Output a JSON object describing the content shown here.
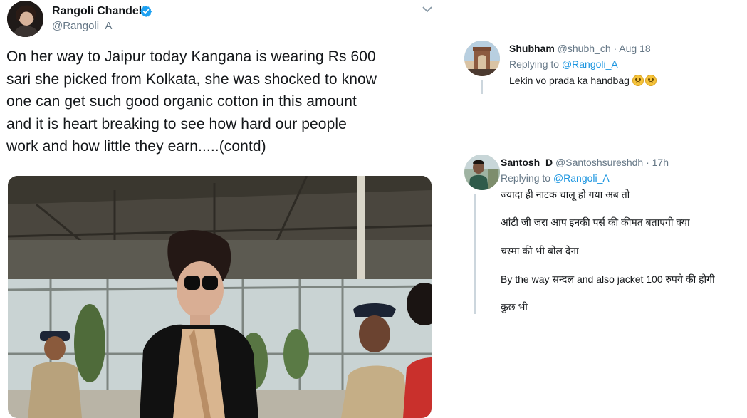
{
  "main_tweet": {
    "author_name": "Rangoli Chandel",
    "author_handle": "@Rangoli_A",
    "verified": true,
    "text_lines": [
      "On her way to Jaipur today Kangana is wearing Rs 600",
      "sari she picked from Kolkata, she was shocked to know",
      "one can get such good organic cotton in this amount",
      "and it is heart breaking to see how hard our people",
      "work and how little they earn.....(contd)"
    ],
    "media_icon": "photo-airport-icon"
  },
  "replies": [
    {
      "name": "Shubham",
      "meta": "@shubh_ch · Aug 18",
      "replying_prefix": "Replying to ",
      "replying_to": "@Rangoli_A",
      "lines": [
        "Lekin vo prada ka handbag"
      ],
      "emoji": "frowning-face-icon"
    },
    {
      "name": "Santosh_D",
      "meta": "@Santoshsureshdh · 17h",
      "replying_prefix": "Replying to ",
      "replying_to": "@Rangoli_A",
      "lines": [
        "ज्यादा ही नाटक चालू हो गया अब तो",
        "आंटी जी जरा आप इनकी पर्स की कीमत बताएगी क्या",
        "चस्मा की भी बोल देना",
        "By the way सन्दल and also jacket 100 रुपये की होगी",
        "कुछ भी"
      ]
    }
  ],
  "colors": {
    "text": "#14171a",
    "secondary": "#657786",
    "link": "#1b95e0",
    "verified": "#1da1f2"
  }
}
